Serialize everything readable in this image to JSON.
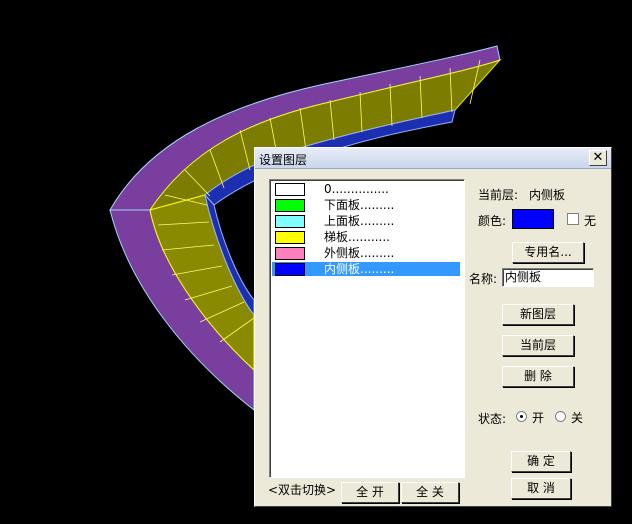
{
  "dialog": {
    "title": "设置图层",
    "close_label": "✕"
  },
  "layers": [
    {
      "label": "0...............",
      "color": "#ffffff"
    },
    {
      "label": "下面板.........",
      "color": "#00ff00"
    },
    {
      "label": "上面板.........",
      "color": "#7fffff"
    },
    {
      "label": "梯板...........",
      "color": "#ffff00"
    },
    {
      "label": "外侧板.........",
      "color": "#ff7fbf"
    },
    {
      "label": "内侧板.........",
      "color": "#0000ff",
      "selected": true
    }
  ],
  "current_layer": {
    "label": "当前层:",
    "value": "内侧板"
  },
  "color_label": "颜色:",
  "current_color": "#0000ff",
  "none_label": "无",
  "special_name_button": "专用名...",
  "name_label": "名称:",
  "name_value": "内侧板",
  "buttons": {
    "new_layer": "新图层",
    "current_layer": "当前层",
    "delete": "删 除",
    "ok": "确 定",
    "cancel": "取 消",
    "open_all": "全 开",
    "close_all": "全 关"
  },
  "double_click_hint": "<双击切换>",
  "status": {
    "label": "状态:",
    "on": "开",
    "off": "关",
    "selected": "on"
  }
}
